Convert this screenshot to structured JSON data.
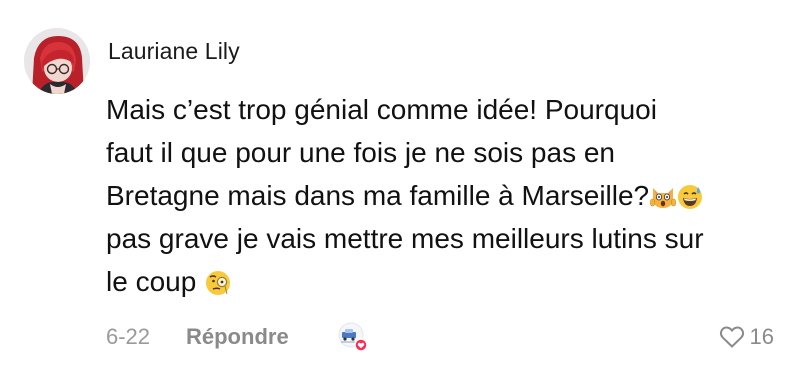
{
  "comment": {
    "username": "Lauriane Lily",
    "lines": [
      "Mais c’est trop génial comme idée! Pourquoi",
      "faut il que pour une fois je ne sois pas en",
      "Bretagne mais dans ma famille à Marseille?",
      "pas grave je vais mettre mes meilleurs lutins sur",
      "le coup"
    ],
    "emojis": [
      "screaming-cat-emoji",
      "grinning-sweat-emoji",
      "monocle-face-emoji"
    ],
    "date": "6-22",
    "reply_label": "Répondre",
    "like_count": "16"
  },
  "colors": {
    "avatar_hair": "#c0272d",
    "creator_heart": "#fe2c55",
    "muted_text": "#8a8a8a"
  },
  "icons": {
    "avatar": "user-avatar",
    "like": "heart-outline-icon",
    "creator_like": "creator-liked-badge"
  }
}
